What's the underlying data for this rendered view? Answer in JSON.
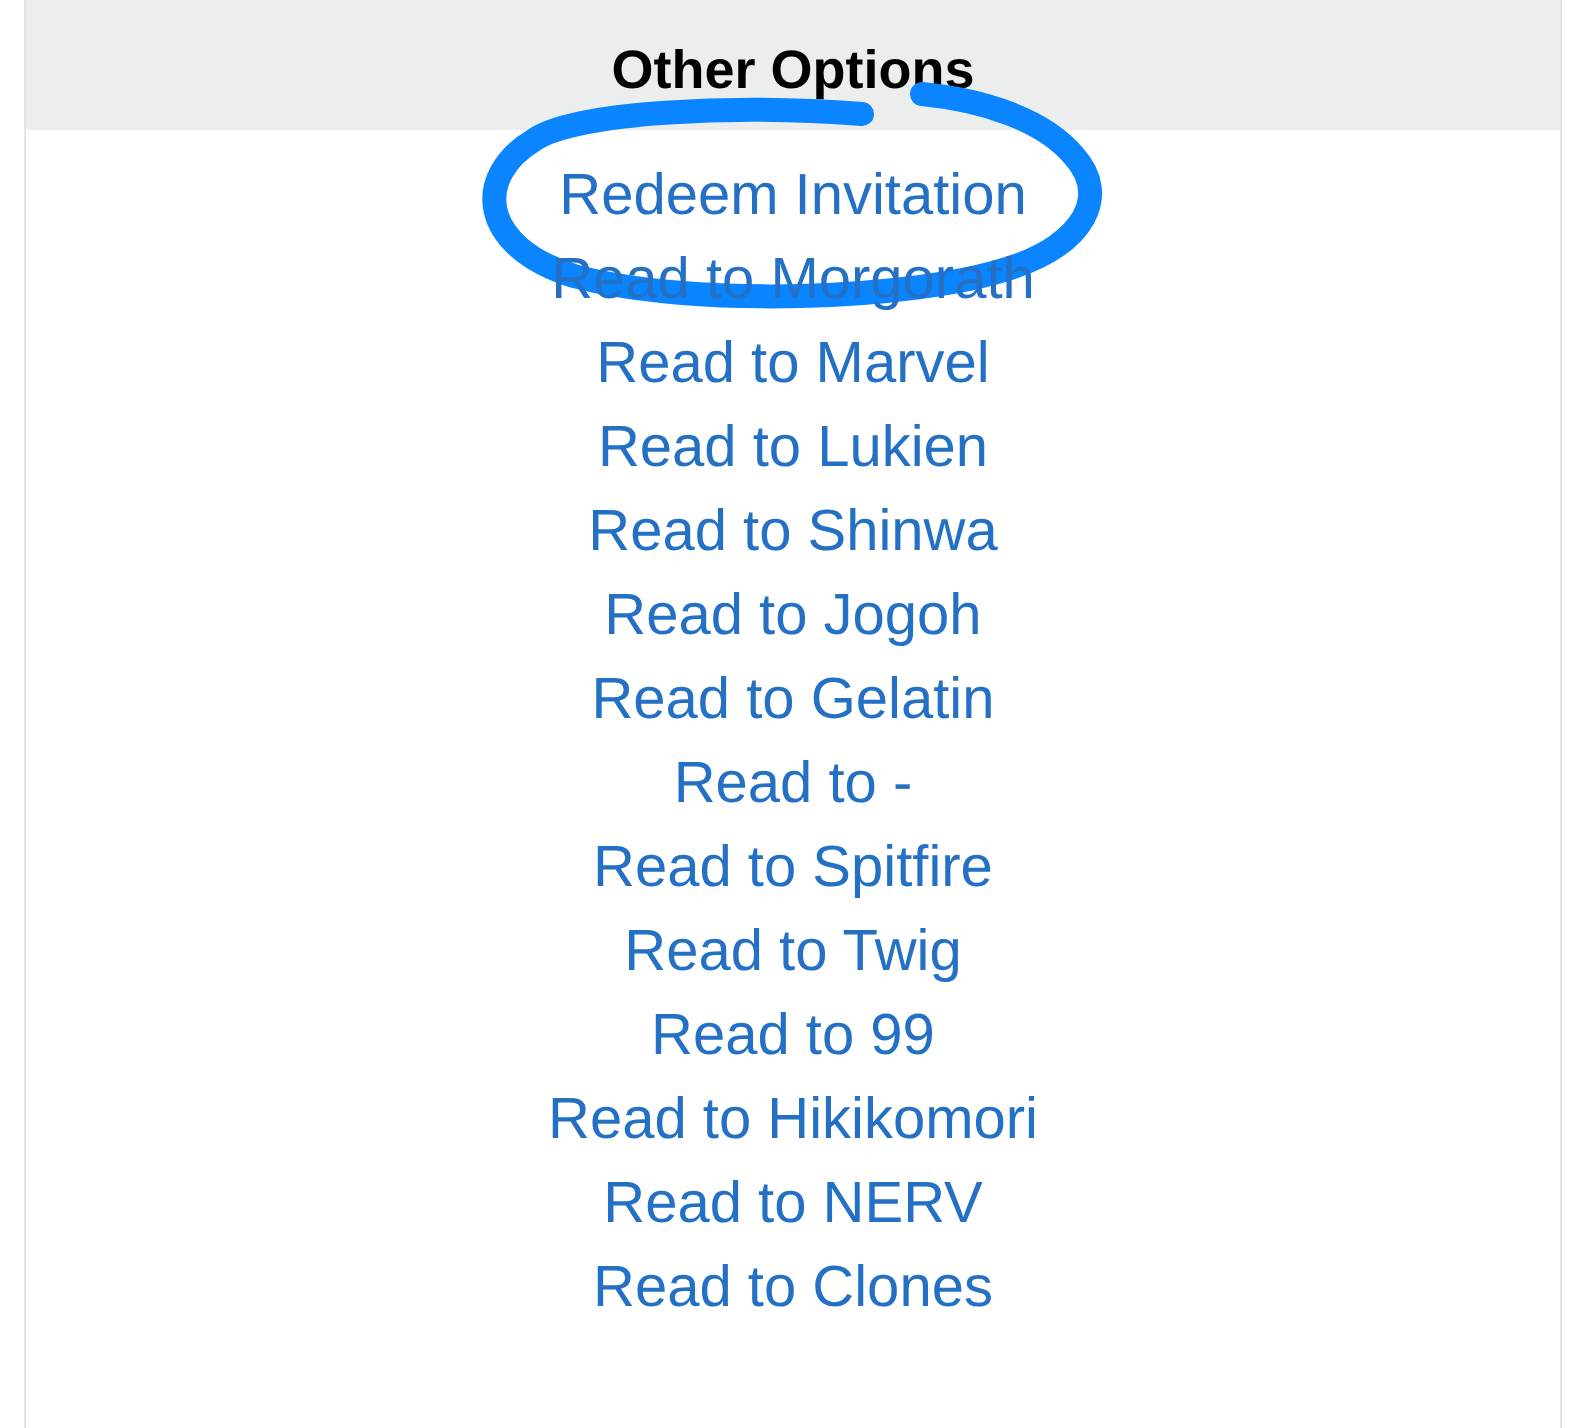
{
  "panel": {
    "title": "Other Options"
  },
  "links": [
    {
      "label": "Redeem Invitation",
      "circled": true
    },
    {
      "label": "Read to Morgorath",
      "circled": false
    },
    {
      "label": "Read to Marvel",
      "circled": false
    },
    {
      "label": "Read to Lukien",
      "circled": false
    },
    {
      "label": "Read to Shinwa",
      "circled": false
    },
    {
      "label": "Read to Jogoh",
      "circled": false
    },
    {
      "label": "Read to Gelatin",
      "circled": false
    },
    {
      "label": "Read to -",
      "circled": false
    },
    {
      "label": "Read to Spitfire",
      "circled": false
    },
    {
      "label": "Read to Twig",
      "circled": false
    },
    {
      "label": "Read to 99",
      "circled": false
    },
    {
      "label": "Read to Hikikomori",
      "circled": false
    },
    {
      "label": "Read to NERV",
      "circled": false
    },
    {
      "label": "Read to Clones",
      "circled": false
    }
  ]
}
